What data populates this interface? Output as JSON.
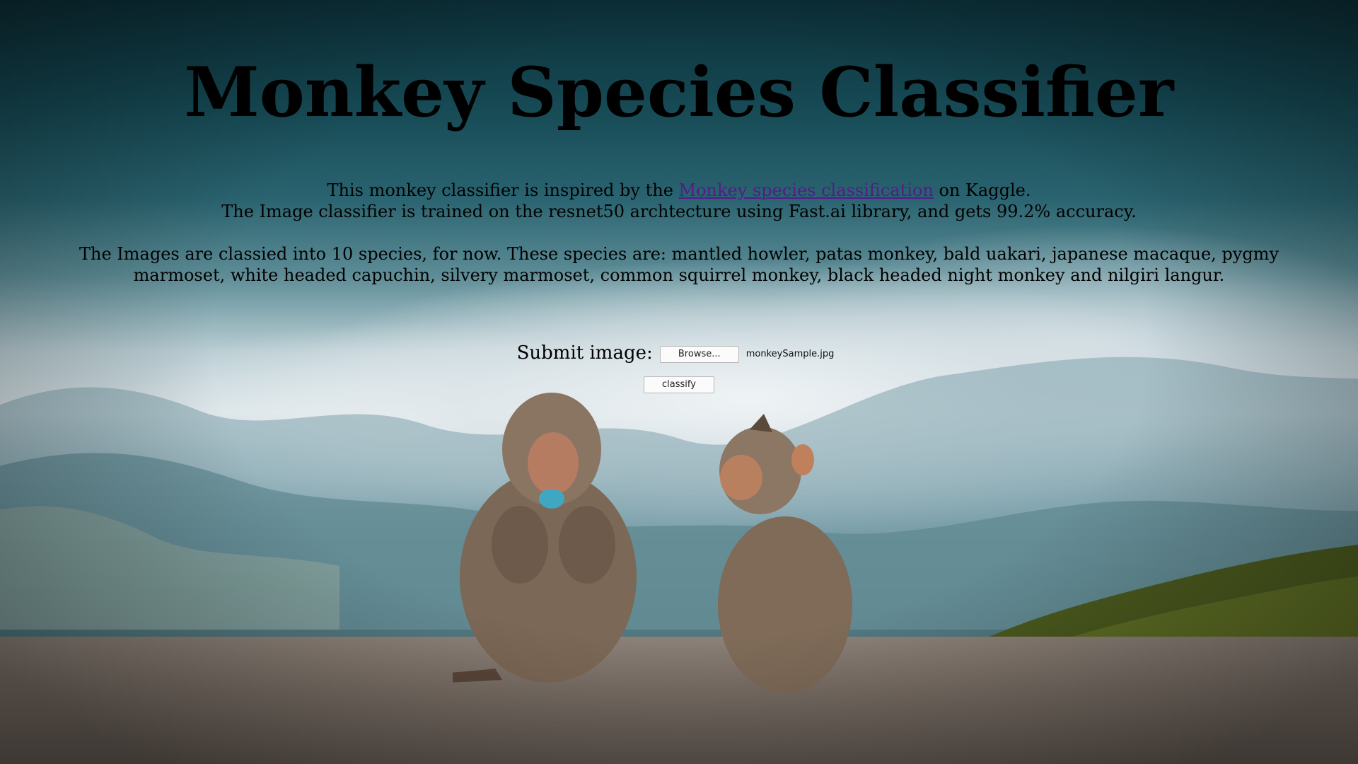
{
  "page": {
    "title": "Monkey Species Classifier"
  },
  "intro": {
    "line1_before": "This monkey classifier is inspired by the ",
    "link_text": "Monkey species classification",
    "line1_after": " on Kaggle.",
    "line2": "The Image classifier is trained on the resnet50 archtecture using Fast.ai library, and gets 99.2% accuracy."
  },
  "species_text": "The Images are classied into 10 species, for now. These species are: mantled howler, patas monkey, bald uakari, japanese macaque, pygmy marmoset, white headed capuchin, silvery marmoset, common squirrel monkey, black headed night monkey and nilgiri langur.",
  "form": {
    "submit_label": "Submit image:",
    "browse_label": "Browse...",
    "file_name": "monkeySample.jpg",
    "classify_label": "classify"
  },
  "colors": {
    "link": "#551a8b",
    "text": "#000000"
  }
}
